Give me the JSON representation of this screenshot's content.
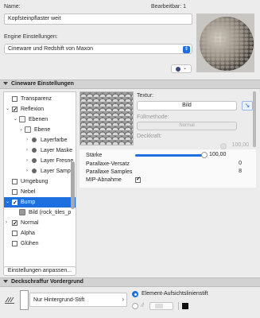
{
  "header": {
    "name_label": "Name:",
    "edit_label": "Bearbeitbar: 1",
    "name_value": "Kopfsteinpflaster weit",
    "engine_label": "Engine Einstellungen:",
    "engine_value": "Cineware und Redshift von Maxon"
  },
  "section_cineware": {
    "title": "Cineware Einstellungen"
  },
  "tree": {
    "items": [
      {
        "label": "Transparenz"
      },
      {
        "label": "Reflexion"
      },
      {
        "label": "Ebenen"
      },
      {
        "label": "Ebene"
      },
      {
        "label": "Layerfarbe"
      },
      {
        "label": "Layer Maske"
      },
      {
        "label": "Layer Fresne"
      },
      {
        "label": "Layer Sampl"
      },
      {
        "label": "Umgebung"
      },
      {
        "label": "Nebel"
      },
      {
        "label": "Bump"
      },
      {
        "label": "Bild (rock_tiles_p"
      },
      {
        "label": "Normal"
      },
      {
        "label": "Alpha"
      },
      {
        "label": "Glühen"
      }
    ],
    "customize_button": "Einstellungen anpassen..."
  },
  "texture": {
    "label": "Textur:",
    "image_button": "Bild",
    "fill_label": "Füllmethode:",
    "fill_value": "Normal",
    "opacity_label": "Deckkraft:",
    "opacity_value": "100,00"
  },
  "properties": {
    "strength_label": "Stärke",
    "strength_value": "100,00",
    "strength_level": 1.0,
    "offset_label": "Parallaxe-Versatz",
    "offset_value": "0",
    "samples_label": "Parallaxe Samples",
    "samples_value": "8",
    "mip_label": "MIP-Abnahme",
    "mip_checked": true
  },
  "section_hatch": {
    "title": "Deckschraffur Vordergrund"
  },
  "hatch": {
    "pen_value": "Nur Hintergrund-Stift",
    "element_option": "Element-Aufsichtslinienstift"
  },
  "colors": {
    "accent": "#1e6fe0",
    "selection": "#1e6fe0"
  }
}
